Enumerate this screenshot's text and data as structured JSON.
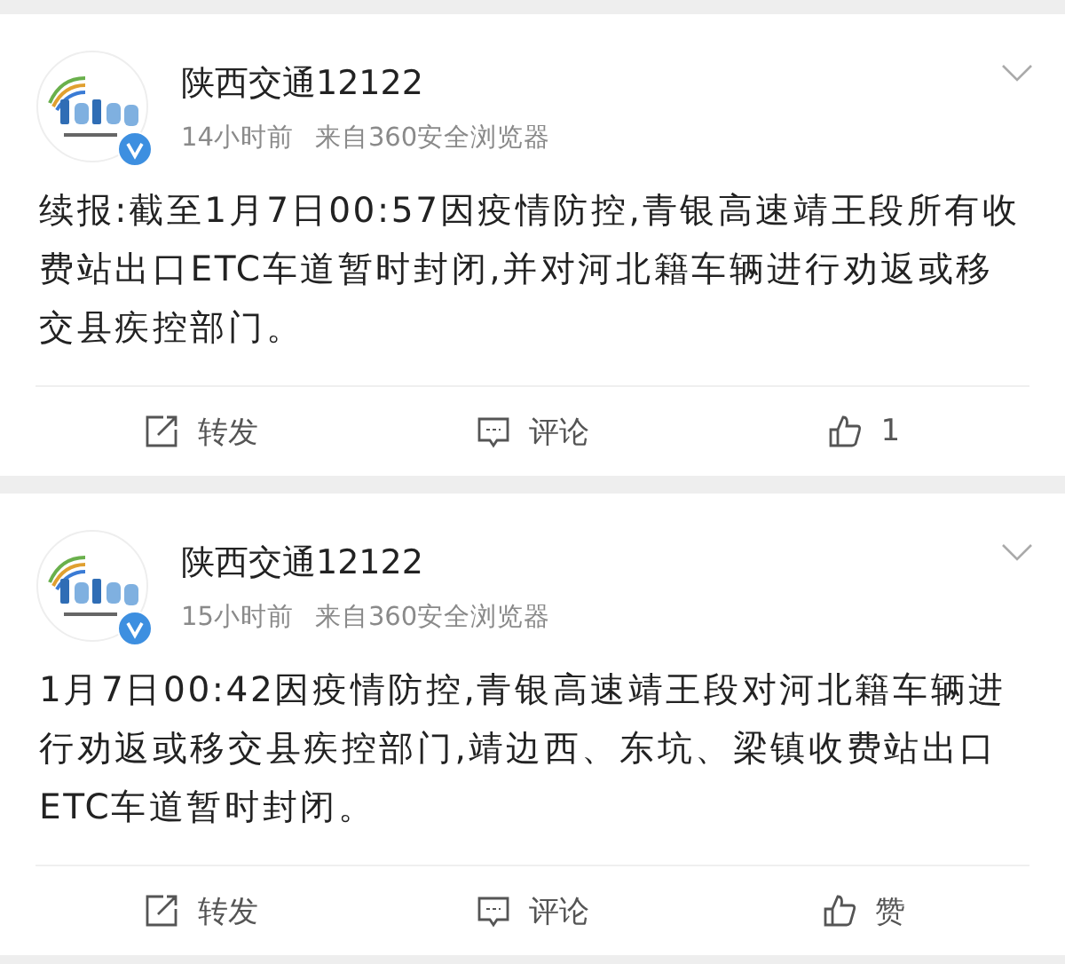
{
  "posts": [
    {
      "author": "陕西交通12122",
      "verified": true,
      "time": "14小时前",
      "source": "来自360安全浏览器",
      "text": "续报:截至1月7日00:57因疫情防控,青银高速靖王段所有收费站出口ETC车道暂时封闭,并对河北籍车辆进行劝返或移交县疾控部门。",
      "actions": {
        "repost": "转发",
        "comment": "评论",
        "like": "1"
      }
    },
    {
      "author": "陕西交通12122",
      "verified": true,
      "time": "15小时前",
      "source": "来自360安全浏览器",
      "text": "1月7日00:42因疫情防控,青银高速靖王段对河北籍车辆进行劝返或移交县疾控部门,靖边西、东坑、梁镇收费站出口ETC车道暂时封闭。",
      "actions": {
        "repost": "转发",
        "comment": "评论",
        "like": "赞"
      }
    }
  ]
}
